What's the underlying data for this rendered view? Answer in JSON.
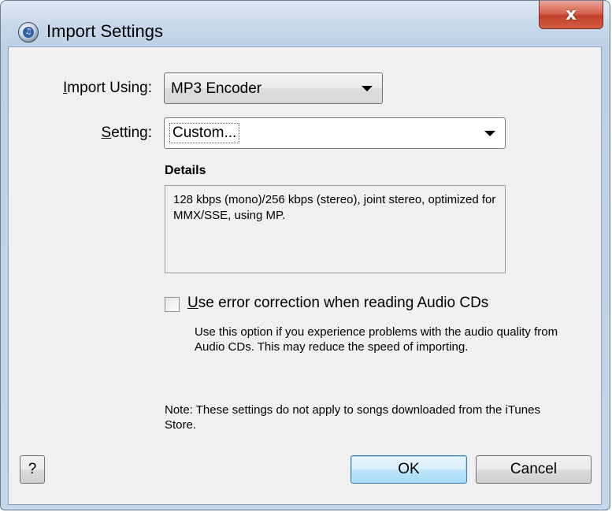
{
  "window": {
    "title": "Import Settings",
    "app_icon": "itunes-icon",
    "close_glyph": "x"
  },
  "form": {
    "import_using": {
      "label_accel": "I",
      "label_rest": "mport Using:",
      "value": "MP3 Encoder"
    },
    "setting": {
      "label_accel": "S",
      "label_rest": "etting:",
      "value": "Custom..."
    }
  },
  "details": {
    "title": "Details",
    "text": "128 kbps (mono)/256 kbps (stereo), joint stereo, optimized for MMX/SSE, using MP."
  },
  "error_correction": {
    "checked": false,
    "label_accel": "U",
    "label_rest": "se error correction when reading Audio CDs",
    "help": "Use this option if you experience problems with the audio quality from Audio CDs.  This may reduce the speed of importing."
  },
  "note": "Note: These settings do not apply to songs downloaded from the iTunes Store.",
  "buttons": {
    "help": "?",
    "ok": "OK",
    "cancel": "Cancel"
  },
  "colors": {
    "close_button": "#c94a33",
    "default_button_border": "#3c7fb1"
  }
}
